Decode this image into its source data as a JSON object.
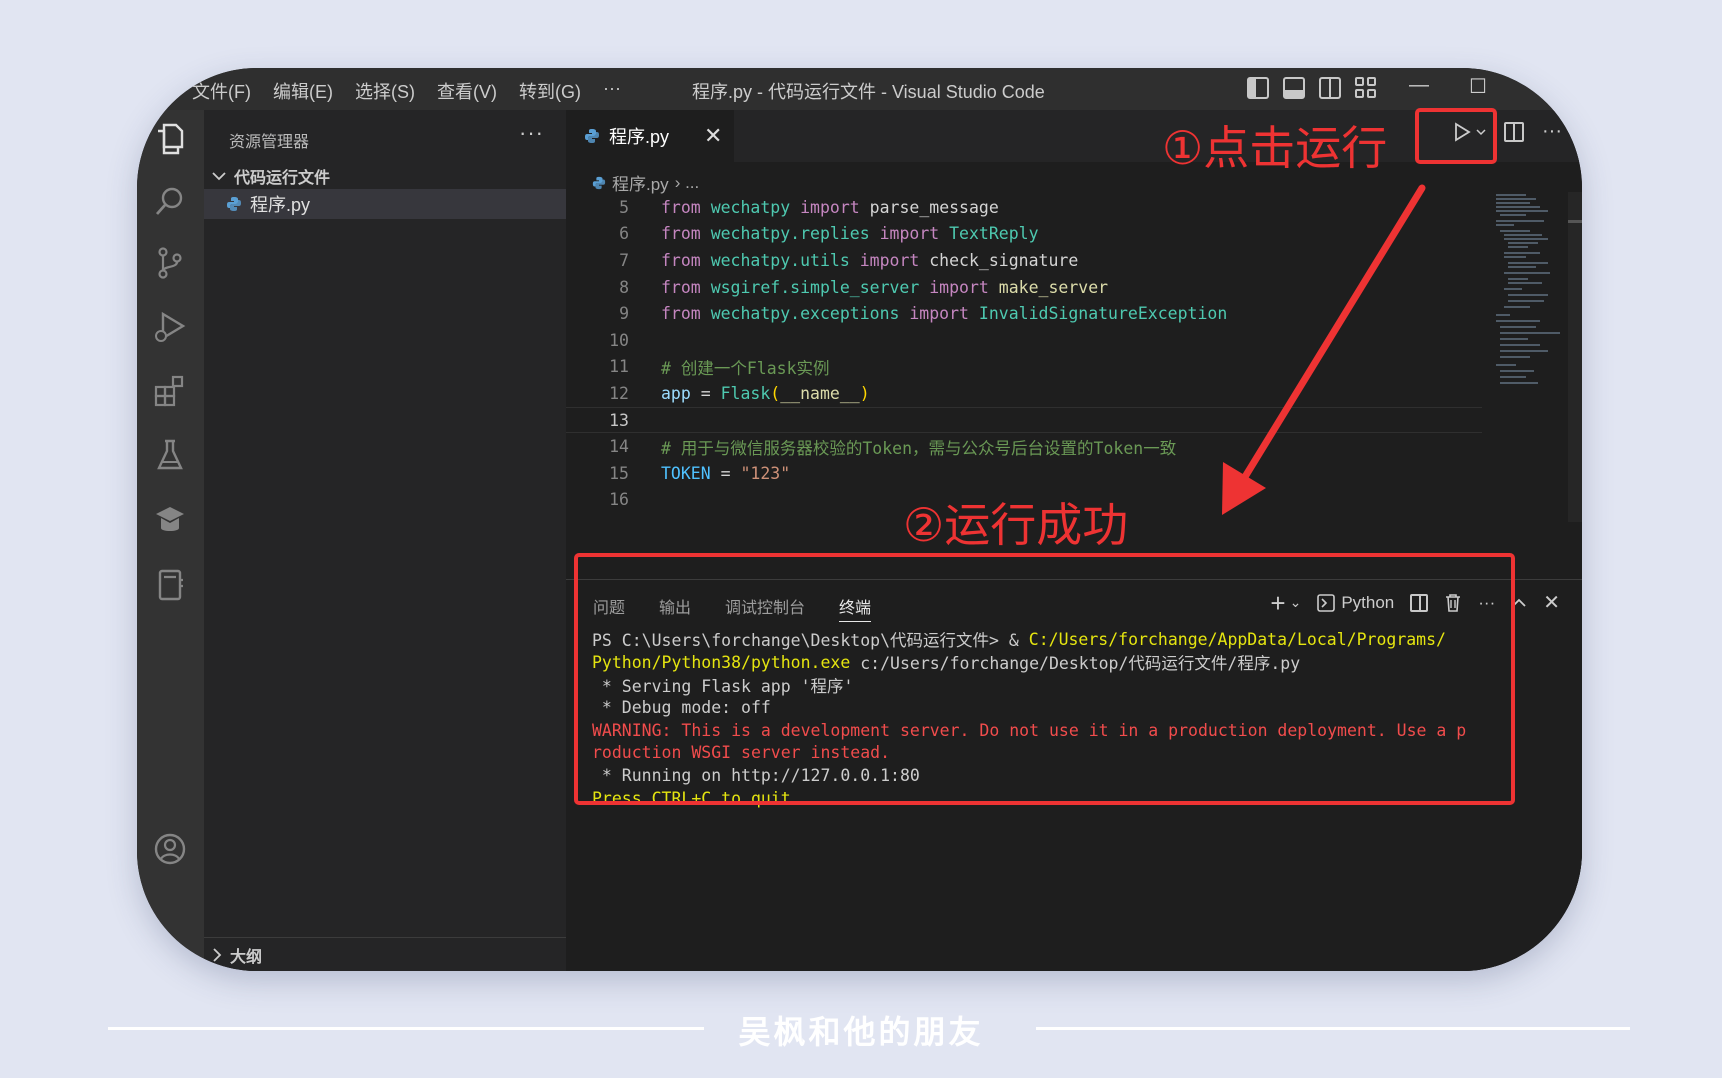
{
  "titlebar": {
    "menu": [
      "文件(F)",
      "编辑(E)",
      "选择(S)",
      "查看(V)",
      "转到(G)",
      "···"
    ],
    "window_title": "程序.py - 代码运行文件 - Visual Studio Code",
    "minimize": "—",
    "maximize": "☐"
  },
  "activity_bar": {
    "items": [
      "files-icon",
      "search-icon",
      "source-control-icon",
      "run-debug-icon",
      "extensions-icon",
      "testing-icon",
      "remote-icon",
      "notebook-icon",
      "account-icon"
    ]
  },
  "sidebar": {
    "title": "资源管理器",
    "more": "···",
    "folder": "代码运行文件",
    "file": "程序.py",
    "outline": "大纲"
  },
  "editor": {
    "tab_label": "程序.py",
    "tab_close": "✕",
    "breadcrumb_file": "程序.py",
    "breadcrumb_rest": "› ...",
    "more": "···",
    "lines": [
      {
        "n": "5",
        "tokens": [
          [
            "kw",
            "from"
          ],
          [
            "op",
            " "
          ],
          [
            "mod",
            "wechatpy"
          ],
          [
            "op",
            " "
          ],
          [
            "kw",
            "import"
          ],
          [
            "op",
            " parse_message"
          ]
        ]
      },
      {
        "n": "6",
        "tokens": [
          [
            "kw",
            "from"
          ],
          [
            "op",
            " "
          ],
          [
            "mod",
            "wechatpy.replies"
          ],
          [
            "op",
            " "
          ],
          [
            "kw",
            "import"
          ],
          [
            "op",
            " "
          ],
          [
            "cls",
            "TextReply"
          ]
        ]
      },
      {
        "n": "7",
        "tokens": [
          [
            "kw",
            "from"
          ],
          [
            "op",
            " "
          ],
          [
            "mod",
            "wechatpy.utils"
          ],
          [
            "op",
            " "
          ],
          [
            "kw",
            "import"
          ],
          [
            "op",
            " check_signature"
          ]
        ]
      },
      {
        "n": "8",
        "tokens": [
          [
            "kw",
            "from"
          ],
          [
            "op",
            " "
          ],
          [
            "mod",
            "wsgiref.simple_server"
          ],
          [
            "op",
            " "
          ],
          [
            "kw",
            "import"
          ],
          [
            "op",
            " "
          ],
          [
            "fn",
            "make_server"
          ]
        ]
      },
      {
        "n": "9",
        "tokens": [
          [
            "kw",
            "from"
          ],
          [
            "op",
            " "
          ],
          [
            "mod",
            "wechatpy.exceptions"
          ],
          [
            "op",
            " "
          ],
          [
            "kw",
            "import"
          ],
          [
            "op",
            " "
          ],
          [
            "cls",
            "InvalidSignatureException"
          ]
        ]
      },
      {
        "n": "10",
        "tokens": []
      },
      {
        "n": "11",
        "tokens": [
          [
            "cm",
            "# 创建一个Flask实例"
          ]
        ]
      },
      {
        "n": "12",
        "tokens": [
          [
            "var",
            "app"
          ],
          [
            "op",
            " = "
          ],
          [
            "cls",
            "Flask"
          ],
          [
            "par",
            "("
          ],
          [
            "dunder",
            "__name__"
          ],
          [
            "par",
            ")"
          ]
        ]
      },
      {
        "n": "13",
        "tokens": []
      },
      {
        "n": "14",
        "tokens": [
          [
            "cm",
            "# 用于与微信服务器校验的Token，需与公众号后台设置的Token一致"
          ]
        ]
      },
      {
        "n": "15",
        "tokens": [
          [
            "const",
            "TOKEN"
          ],
          [
            "op",
            " = "
          ],
          [
            "str",
            "\"123\""
          ]
        ]
      },
      {
        "n": "16",
        "tokens": []
      }
    ],
    "current_line": "13"
  },
  "panel": {
    "tabs": [
      "问题",
      "输出",
      "调试控制台",
      "终端"
    ],
    "active_tab": "终端",
    "plus": "+",
    "chevron": "⌄",
    "shell_label": "Python",
    "more": "···",
    "up": "^",
    "close": "✕",
    "terminal_lines": [
      [
        [
          "n",
          "PS C:\\Users\\forchange\\Desktop\\代码运行文件> & "
        ],
        [
          "y",
          "C:/Users/forchange/AppData/Local/Programs/"
        ]
      ],
      [
        [
          "y",
          "Python/Python38/python.exe"
        ],
        [
          "n",
          " c:/Users/forchange/Desktop/代码运行文件/程序.py"
        ]
      ],
      [
        [
          "n",
          " * Serving Flask app '程序'"
        ]
      ],
      [
        [
          "n",
          " * Debug mode: off"
        ]
      ],
      [
        [
          "r",
          "WARNING: This is a development server. Do not use it in a production deployment. Use a p"
        ]
      ],
      [
        [
          "r",
          "roduction WSGI server instead."
        ]
      ],
      [
        [
          "n",
          " * Running on http://127.0.0.1:80"
        ]
      ],
      [
        [
          "y",
          "Press CTRL+C to quit"
        ]
      ]
    ]
  },
  "annotations": {
    "step1": "①点击运行",
    "step2": "②运行成功",
    "color": "#ee3333"
  },
  "footer": {
    "text": "吴枫和他的朋友"
  }
}
